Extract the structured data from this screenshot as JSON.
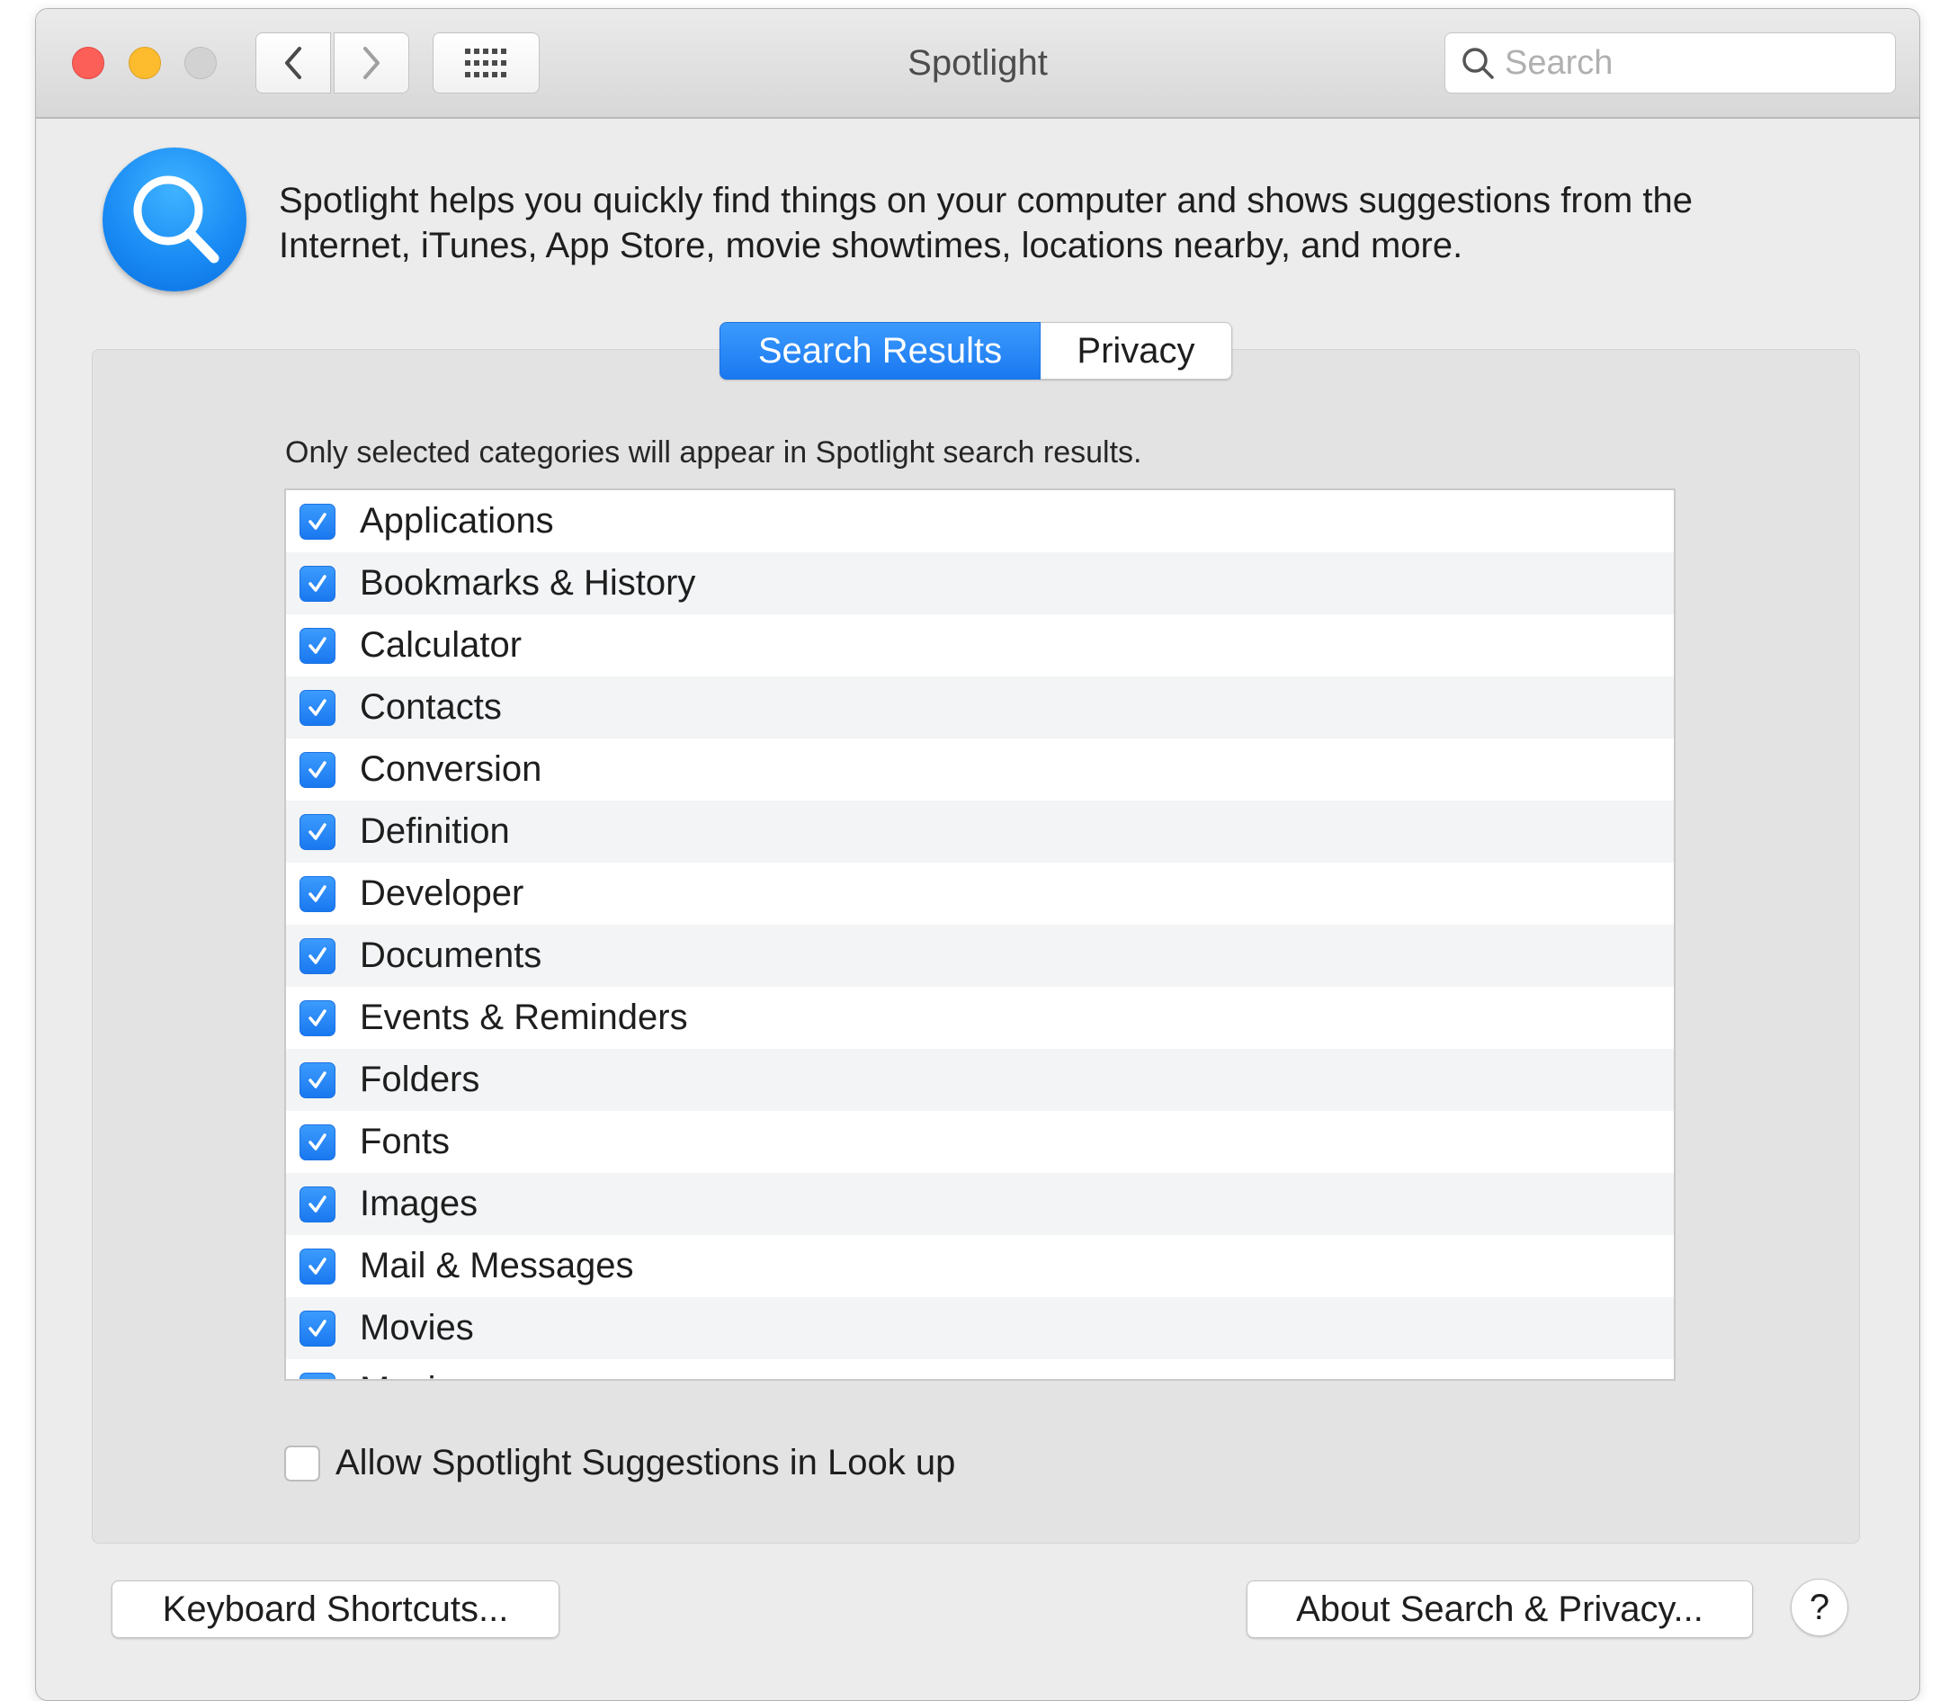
{
  "window": {
    "title": "Spotlight",
    "search_placeholder": "Search"
  },
  "header": {
    "description_line1": "Spotlight helps you quickly find things on your computer and shows suggestions from the",
    "description_line2": "Internet, iTunes, App Store, movie showtimes, locations nearby, and more."
  },
  "tabs": [
    {
      "label": "Search Results",
      "selected": true
    },
    {
      "label": "Privacy",
      "selected": false
    }
  ],
  "hint": "Only selected categories will appear in Spotlight search results.",
  "categories": [
    {
      "label": "Applications",
      "checked": true
    },
    {
      "label": "Bookmarks & History",
      "checked": true
    },
    {
      "label": "Calculator",
      "checked": true
    },
    {
      "label": "Contacts",
      "checked": true
    },
    {
      "label": "Conversion",
      "checked": true
    },
    {
      "label": "Definition",
      "checked": true
    },
    {
      "label": "Developer",
      "checked": true
    },
    {
      "label": "Documents",
      "checked": true
    },
    {
      "label": "Events & Reminders",
      "checked": true
    },
    {
      "label": "Folders",
      "checked": true
    },
    {
      "label": "Fonts",
      "checked": true
    },
    {
      "label": "Images",
      "checked": true
    },
    {
      "label": "Mail & Messages",
      "checked": true
    },
    {
      "label": "Movies",
      "checked": true
    },
    {
      "label": "Music",
      "checked": true
    }
  ],
  "suggestions_option": {
    "label": "Allow Spotlight Suggestions in Look up",
    "checked": false
  },
  "buttons": {
    "keyboard_shortcuts": "Keyboard Shortcuts...",
    "about": "About Search & Privacy...",
    "help": "?"
  },
  "colors": {
    "accent": "#1a78f0",
    "close": "#fc5f57",
    "minimize": "#fdbc2e",
    "zoom_disabled": "#d2d2d2"
  }
}
